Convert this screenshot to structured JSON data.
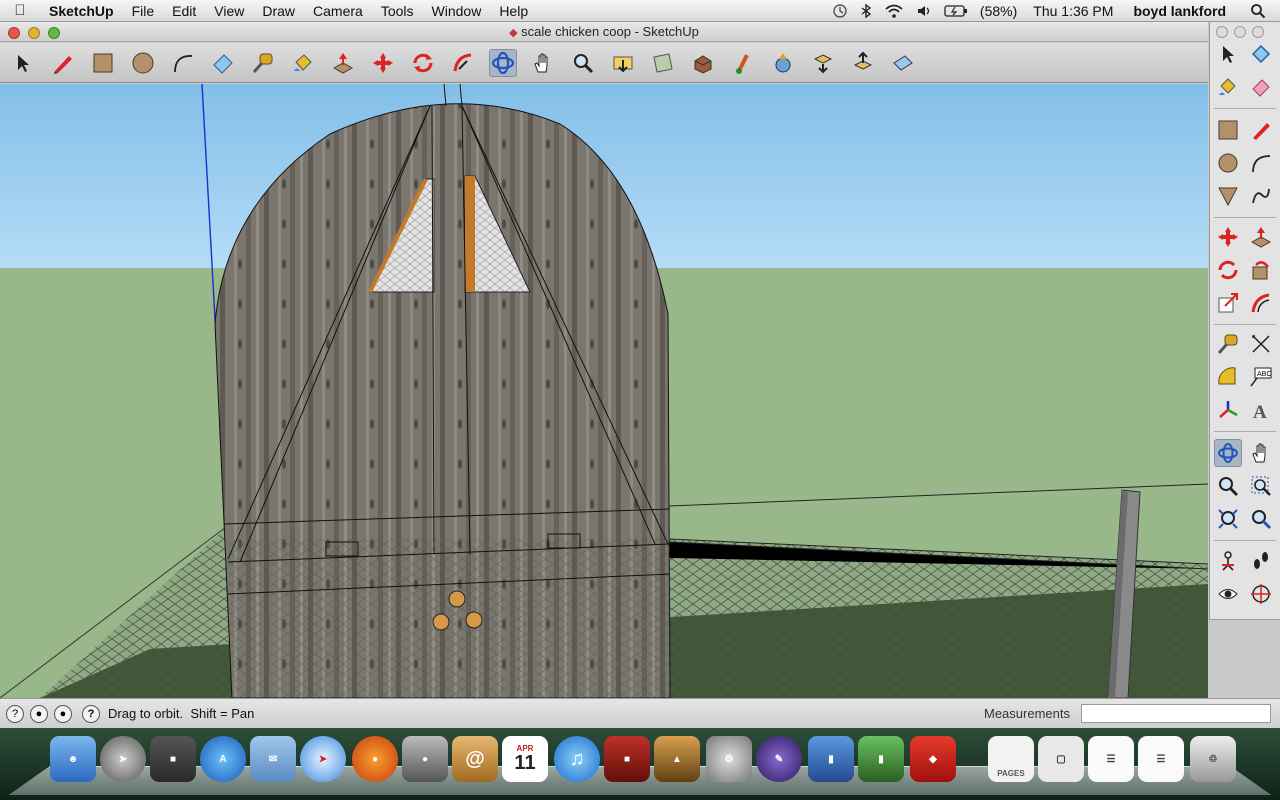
{
  "menubar": {
    "app_name": "SketchUp",
    "items": [
      "File",
      "Edit",
      "View",
      "Draw",
      "Camera",
      "Tools",
      "Window",
      "Help"
    ],
    "battery": "(58%)",
    "clock": "Thu 1:36 PM",
    "user": "boyd lankford"
  },
  "window": {
    "title": "scale chicken coop - SketchUp"
  },
  "toolbar": {
    "tools": [
      "select-tool",
      "pencil-tool",
      "rectangle-tool",
      "circle-tool",
      "arc-tool",
      "eraser-tool",
      "tape-measure-tool",
      "paint-bucket-tool",
      "push-pull-tool",
      "move-tool",
      "rotate-tool",
      "follow-me-tool",
      "orbit-tool",
      "pan-tool",
      "zoom-tool",
      "zoom-extents-tool",
      "previous-view-tool",
      "next-view-tool",
      "get-models-tool",
      "share-model-tool",
      "get-photo-texture-tool",
      "component-tool",
      "upload-tool",
      "sandbox-tool"
    ],
    "active": "orbit-tool"
  },
  "right_palette": {
    "tools": [
      "select",
      "component",
      "paint-bucket",
      "eraser",
      "rectangle",
      "line",
      "circle",
      "arc",
      "polygon",
      "freehand",
      "move",
      "push-pull",
      "rotate",
      "follow-me",
      "scale",
      "offset",
      "tape-measure",
      "dimension",
      "protractor",
      "text",
      "axes",
      "3d-text",
      "orbit",
      "pan",
      "zoom",
      "zoom-window",
      "zoom-extents",
      "previous",
      "position-camera",
      "walk",
      "look-around",
      "section-plane"
    ],
    "active": "orbit"
  },
  "status": {
    "hint": "Drag to orbit.  Shift = Pan",
    "measurements_label": "Measurements",
    "measurements_value": ""
  },
  "dock": {
    "apps": [
      "Finder",
      "Launchpad",
      "Photo Booth",
      "App Store",
      "Mail",
      "Safari",
      "Firefox",
      "FaceTime",
      "Address Book",
      "iCal",
      "iTunes",
      "Photo Booth Curtain",
      "iPhoto",
      "System Preferences",
      "Pen",
      "Keynote",
      "Numbers",
      "SketchUp",
      "Pages",
      "Preview",
      "Document",
      "Document",
      "Trash"
    ],
    "ical_day": "11",
    "ical_month": "APR",
    "pages_label": "PAGES"
  },
  "colors": {
    "sky": "#8fc4ea",
    "ground": "#97b887",
    "wood": "#7b766d",
    "axis_blue": "#1a2fd0",
    "selection": "#a9b4c4"
  }
}
